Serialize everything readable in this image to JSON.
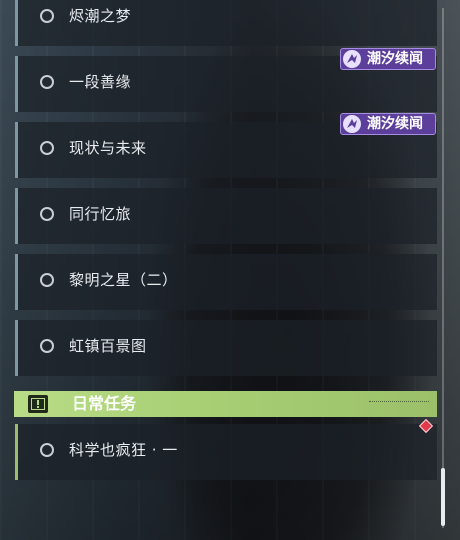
{
  "tasks": [
    {
      "label": "烬潮之梦"
    },
    {
      "label": "一段善缘"
    },
    {
      "label": "现状与未来"
    },
    {
      "label": "同行忆旅"
    },
    {
      "label": "黎明之星（二）"
    },
    {
      "label": "虹镇百景图"
    }
  ],
  "badges": [
    {
      "text": "潮汐续闻"
    },
    {
      "text": "潮汐续闻"
    }
  ],
  "daily": {
    "title": "日常任务",
    "tasks": [
      {
        "label": "科学也疯狂 · 一"
      }
    ]
  },
  "colors": {
    "daily_accent": "#b8dc86",
    "badge_purple": "#5b3f9a",
    "tracked_marker": "#e4384d"
  }
}
